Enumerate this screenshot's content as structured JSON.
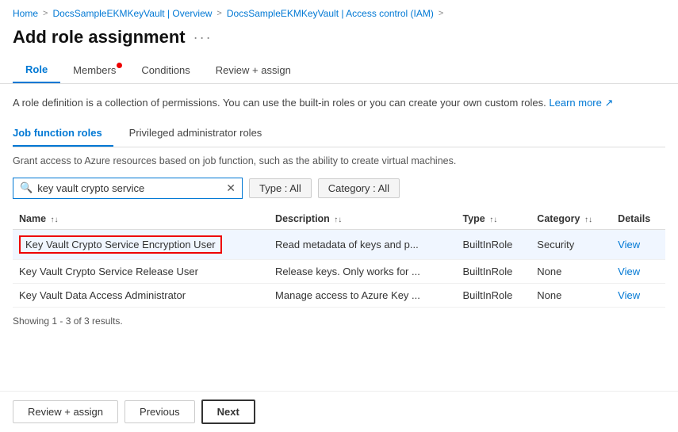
{
  "breadcrumb": {
    "items": [
      {
        "label": "Home",
        "link": true
      },
      {
        "label": "DocsSampleEKMKeyVault | Overview",
        "link": true
      },
      {
        "label": "DocsSampleEKMKeyVault | Access control (IAM)",
        "link": true
      }
    ],
    "separator": ">"
  },
  "page": {
    "title": "Add role assignment",
    "more_icon": "···"
  },
  "tabs": [
    {
      "id": "role",
      "label": "Role",
      "active": true,
      "dot": false
    },
    {
      "id": "members",
      "label": "Members",
      "active": false,
      "dot": true
    },
    {
      "id": "conditions",
      "label": "Conditions",
      "active": false,
      "dot": false
    },
    {
      "id": "review-assign",
      "label": "Review + assign",
      "active": false,
      "dot": false
    }
  ],
  "role_tab": {
    "description": "A role definition is a collection of permissions. You can use the built-in roles or you can create your own custom roles.",
    "learn_more": "Learn more",
    "sub_tabs": [
      {
        "id": "job-function",
        "label": "Job function roles",
        "active": true
      },
      {
        "id": "privileged",
        "label": "Privileged administrator roles",
        "active": false
      }
    ],
    "sub_description": "Grant access to Azure resources based on job function, such as the ability to create virtual machines.",
    "search": {
      "placeholder": "key vault crypto service",
      "value": "key vault crypto service"
    },
    "filters": [
      {
        "id": "type",
        "label": "Type : All"
      },
      {
        "id": "category",
        "label": "Category : All"
      }
    ],
    "table": {
      "columns": [
        {
          "id": "name",
          "label": "Name",
          "sortable": true
        },
        {
          "id": "description",
          "label": "Description",
          "sortable": true
        },
        {
          "id": "type",
          "label": "Type",
          "sortable": true
        },
        {
          "id": "category",
          "label": "Category",
          "sortable": true
        },
        {
          "id": "details",
          "label": "Details",
          "sortable": false
        }
      ],
      "rows": [
        {
          "name": "Key Vault Crypto Service Encryption User",
          "description": "Read metadata of keys and p...",
          "type": "BuiltInRole",
          "category": "Security",
          "details": "View",
          "selected": true
        },
        {
          "name": "Key Vault Crypto Service Release User",
          "description": "Release keys. Only works for ...",
          "type": "BuiltInRole",
          "category": "None",
          "details": "View",
          "selected": false
        },
        {
          "name": "Key Vault Data Access Administrator",
          "description": "Manage access to Azure Key ...",
          "type": "BuiltInRole",
          "category": "None",
          "details": "View",
          "selected": false
        }
      ]
    },
    "showing_text": "Showing 1 - 3 of 3 results."
  },
  "action_bar": {
    "review_assign": "Review + assign",
    "previous": "Previous",
    "next": "Next"
  }
}
